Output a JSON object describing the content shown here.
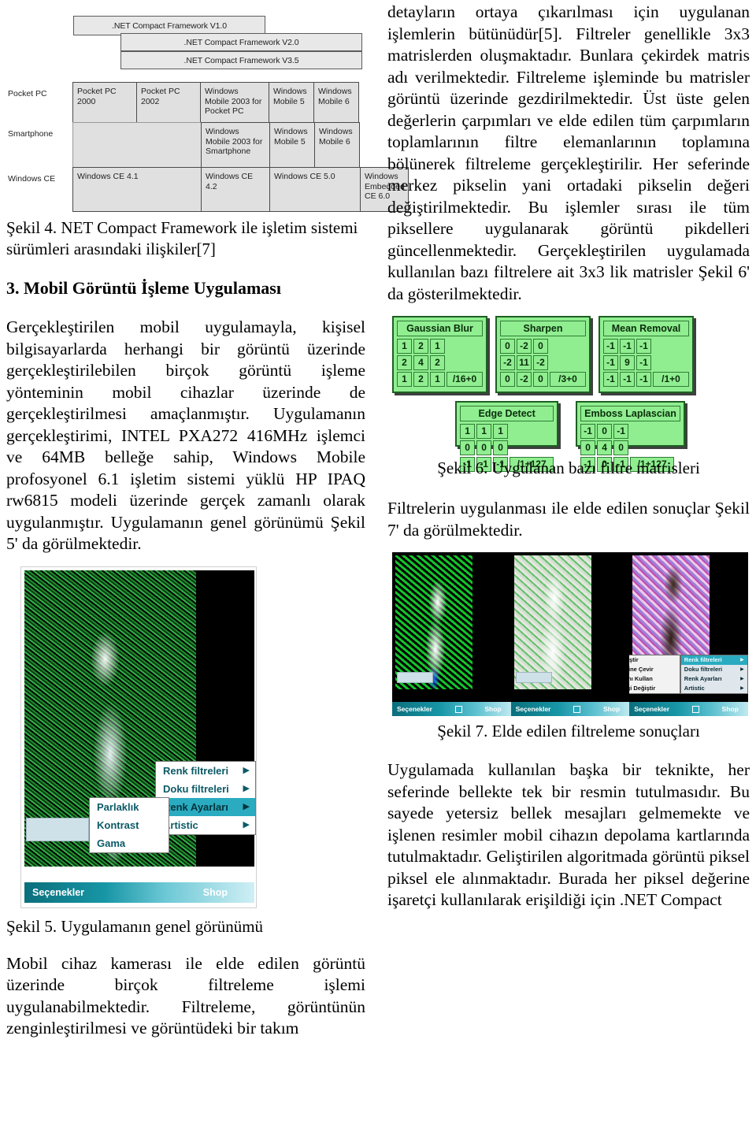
{
  "left_column": {
    "figure4": {
      "bars": [
        ".NET Compact Framework V1.0",
        ".NET Compact Framework V2.0",
        ".NET Compact Framework V3.5"
      ],
      "row_labels": [
        "Pocket PC",
        "Smartphone",
        "Windows CE"
      ],
      "rows": [
        [
          "Pocket PC 2000",
          "Pocket PC 2002",
          "Windows Mobile 2003 for Pocket PC",
          "Windows Mobile 5",
          "Windows Mobile 6"
        ],
        [
          "",
          "Windows Mobile 2003 for Smartphone",
          "Windows Mobile 5",
          "Windows Mobile 6"
        ],
        [
          "Windows CE 4.1",
          "Windows CE 4.2",
          "Windows CE 5.0",
          "Windows Embedded CE 6.0"
        ]
      ],
      "caption": "Şekil 4. NET Compact Framework ile işletim sistemi sürümleri arasındaki ilişkiler[7]"
    },
    "section_heading": "3. Mobil Görüntü İşleme Uygulaması",
    "paragraph1": "Gerçekleştirilen mobil uygulamayla, kişisel bilgisayarlarda herhangi bir görüntü üzerinde gerçekleştirilebilen birçok görüntü işleme yönteminin mobil cihazlar üzerinde de gerçekleştirilmesi amaçlanmıştır. Uygulamanın gerçekleştirimi, INTEL PXA272 416MHz işlemci ve 64MB belleğe sahip, Windows Mobile profosyonel 6.1 işletim sistemi yüklü HP IPAQ rw6815 modeli üzerinde gerçek zamanlı olarak uygulanmıştır. Uygulamanın genel görünümü Şekil 5' da görülmektedir.",
    "figure5": {
      "caption": "Şekil 5. Uygulamanın genel görünümü",
      "taskbar": {
        "left_label": "Seçenekler",
        "right_label": "Shop"
      },
      "main_menu": [
        {
          "label": "Renk filtreleri",
          "arrow": "▶",
          "selected": false
        },
        {
          "label": "Doku filtreleri",
          "arrow": "▶",
          "selected": false
        },
        {
          "label": "Renk Ayarları",
          "arrow": "▶",
          "selected": true
        },
        {
          "label": "Artistic",
          "arrow": "▶",
          "selected": false
        }
      ],
      "sub_menu": [
        {
          "label": "Parlaklık"
        },
        {
          "label": "Kontrast"
        },
        {
          "label": "Gama"
        }
      ]
    },
    "paragraph2": "Mobil cihaz kamerası ile elde edilen görüntü üzerinde birçok filtreleme işlemi uygulanabilmektedir. Filtreleme, görüntünün zenginleştirilmesi ve görüntüdeki bir takım"
  },
  "right_column": {
    "paragraph1": "detayların ortaya çıkarılması için uygulanan işlemlerin bütünüdür[5]. Filtreler genellikle 3x3 matrislerden oluşmaktadır. Bunlara çekirdek matris adı verilmektedir. Filtreleme işleminde bu matrisler görüntü üzerinde gezdirilmektedir. Üst üste gelen değerlerin çarpımları ve elde edilen tüm çarpımların toplamlarının filtre elemanlarının toplamına bölünerek filtreleme gerçekleştirilir. Her seferinde merkez pikselin yani ortadaki pikselin değeri değiştirilmektedir. Bu işlemler sırası ile tüm piksellere uygulanarak görüntü pikdelleri güncellenmektedir. Gerçekleştirilen uygulamada kullanılan bazı filtrelere ait 3x3 lik matrisler Şekil 6' da gösterilmektedir.",
    "figure6": {
      "caption": "Şekil 6. Uygulanan bazı filtre matrisleri",
      "matrices": [
        {
          "title": "Gaussian Blur",
          "rows": [
            [
              "1",
              "2",
              "1"
            ],
            [
              "2",
              "4",
              "2"
            ],
            [
              "1",
              "2",
              "1"
            ]
          ],
          "divisor": "/16+0"
        },
        {
          "title": "Sharpen",
          "rows": [
            [
              "0",
              "-2",
              "0"
            ],
            [
              "-2",
              "11",
              "-2"
            ],
            [
              "0",
              "-2",
              "0"
            ]
          ],
          "divisor": "/3+0"
        },
        {
          "title": "Mean Removal",
          "rows": [
            [
              "-1",
              "-1",
              "-1"
            ],
            [
              "-1",
              "9",
              "-1"
            ],
            [
              "-1",
              "-1",
              "-1"
            ]
          ],
          "divisor": "/1+0"
        },
        {
          "title": "Edge Detect",
          "rows": [
            [
              "1",
              "1",
              "1"
            ],
            [
              "0",
              "0",
              "0"
            ],
            [
              "-1",
              "-1",
              "-1"
            ]
          ],
          "divisor": "/1+127"
        },
        {
          "title": "Emboss Laplascian",
          "rows": [
            [
              "-1",
              "0",
              "-1"
            ],
            [
              "0",
              "4",
              "0"
            ],
            [
              "-1",
              "0",
              "-1"
            ]
          ],
          "divisor": "/1+127"
        }
      ]
    },
    "paragraph2": "Filtrelerin uygulanması ile elde edilen sonuçlar Şekil 7' da görülmektedir.",
    "figure7": {
      "caption": "Şekil 7. Elde edilen filtreleme sonuçları",
      "taskbar": {
        "left_label": "Seçenekler",
        "right_label": "Shop"
      },
      "sub_menu": [
        {
          "label": "Rengi Değiştir"
        },
        {
          "label": "Rengi Tersine Çevir"
        },
        {
          "label": "Gri Tonlarını Kullan"
        },
        {
          "label": "Seçili Rengi Değiştir"
        }
      ],
      "main_menu": [
        {
          "label": "Renk filtreleri",
          "arrow": "▶",
          "selected": true
        },
        {
          "label": "Doku filtreleri",
          "arrow": "▶",
          "selected": false
        },
        {
          "label": "Renk Ayarları",
          "arrow": "▶",
          "selected": false
        },
        {
          "label": "Artistic",
          "arrow": "▶",
          "selected": false
        }
      ]
    },
    "paragraph3": "Uygulamada kullanılan başka bir teknikte, her seferinde bellekte tek bir resmin tutulmasıdır. Bu sayede yetersiz bellek mesajları gelmemekte ve işlenen resimler mobil cihazın depolama kartlarında tutulmaktadır. Geliştirilen algoritmada görüntü piksel piksel ele alınmaktadır. Burada her piksel değerine işaretçi kullanılarak erişildiği için .NET Compact"
  }
}
